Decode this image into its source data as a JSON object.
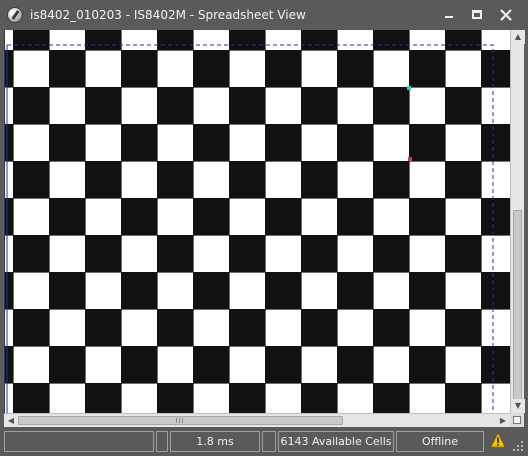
{
  "window": {
    "title": "is8402_010203 - IS8402M - Spreadsheet View",
    "icon": "app-camera-icon"
  },
  "title_buttons": {
    "minimize": "minimize-icon",
    "maximize": "maximize-icon",
    "close": "close-icon"
  },
  "image": {
    "content": "checkerboard-calibration-target",
    "colors": {
      "dark_square": "#111111",
      "light_square": "#ffffff",
      "overlay_line": "#1a2fb8",
      "marker_cyan": "#2bd1c4",
      "marker_red": "#d83a3a"
    }
  },
  "statusbar": {
    "acquisition_time": "1.8 ms",
    "available_cells": "6143 Available Cells",
    "connection": "Offline",
    "warning_icon": "warning-triangle-icon",
    "warning_color": "#f2c300"
  }
}
